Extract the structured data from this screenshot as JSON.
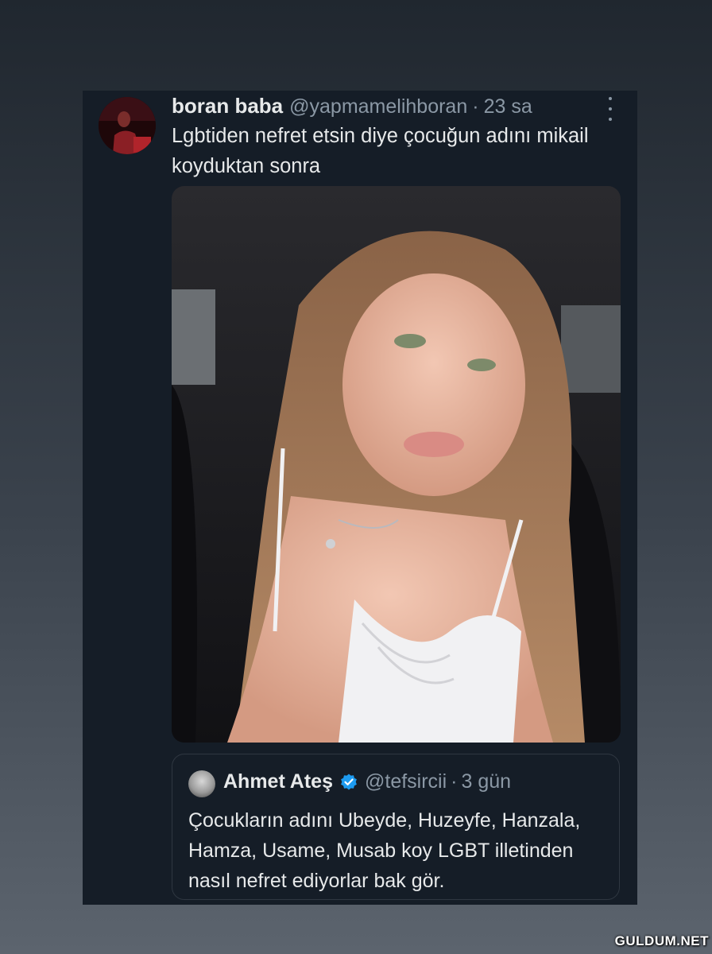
{
  "tweet": {
    "display_name": "boran baba",
    "handle": "@yapmamelihboran",
    "separator": "·",
    "time": "23 sa",
    "text": "Lgbtiden nefret etsin diye çocuğun adını mikail koyduktan sonra",
    "more_icon": "more-vertical-icon"
  },
  "quoted_tweet": {
    "display_name": "Ahmet Ateş",
    "verified_icon": "verified-badge-icon",
    "handle": "@tefsircii",
    "separator": "·",
    "time": "3 gün",
    "text": "Çocukların adını Ubeyde, Huzeyfe, Hanzala, Hamza, Usame, Musab koy LGBT illetinden nasıl nefret ediyorlar bak gör."
  },
  "watermark": "GULDUM.NET",
  "colors": {
    "card_background": "#151d27",
    "primary_text": "#e7e9ea",
    "secondary_text": "#8b98a5",
    "verified_blue": "#1d9bf0"
  }
}
